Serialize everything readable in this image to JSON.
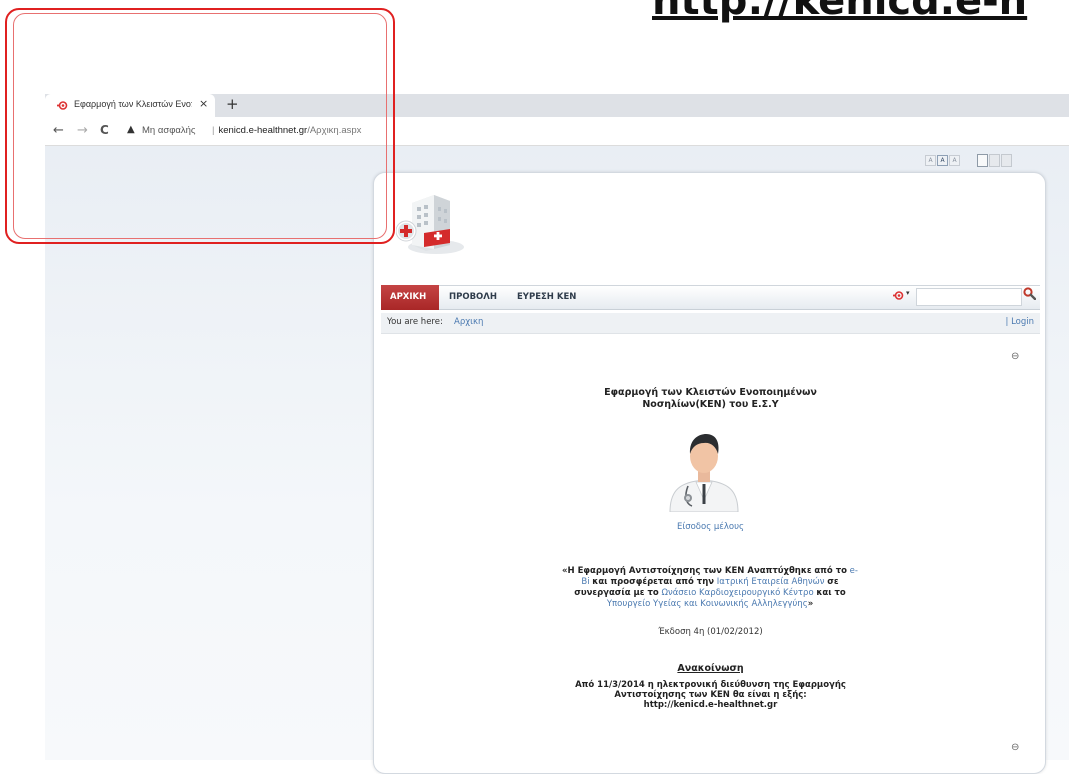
{
  "overlay": {
    "big_url": "http://kenicd.e-h"
  },
  "browser": {
    "tab_title": "Εφαρμογή των Κλειστών Ενοποι",
    "tab_close": "×",
    "new_tab": "+",
    "back_icon": "←",
    "forward_icon": "→",
    "reload_icon": "C",
    "warning_icon": "▲",
    "insecure_label": "Μη ασφαλής",
    "separator": "|",
    "url_host": "kenicd.e-healthnet.gr",
    "url_path": "/Αρχικη.aspx"
  },
  "size_controls": {
    "font_small": "A",
    "font_medium": "A",
    "font_large": "A"
  },
  "menu": {
    "items": [
      {
        "label": "ΑΡΧΙΚΗ",
        "active": true
      },
      {
        "label": "ΠΡΟΒΟΛΗ"
      },
      {
        "label": "ΕΥΡΕΣΗ ΚΕΝ"
      }
    ],
    "lang_caret": "▾"
  },
  "breadcrumb": {
    "label": "You are here:",
    "current": "Αρχικη",
    "login": "| Login"
  },
  "collapse_icon": "⊖",
  "content": {
    "title_line1": "Εφαρμογή των Κλειστών Ενοποιημένων",
    "title_line2": "Νοσηλίων(ΚΕΝ) του Ε.Σ.Υ",
    "member_login": "Είσοδος μέλους",
    "desc": {
      "part1": "«Η Εφαρμογή Αντιστοίχησης των ΚΕΝ Αναπτύχθηκε",
      "part2": "από το",
      "link_ebi": "e-Bi",
      "part3": "και προσφέρεται από την",
      "link_hospital": "Ιατρική Εταιρεία Αθηνών",
      "part4": "σε συνεργασία με το",
      "link_center": "Ωνάσειο Καρδιοχειρουργικό Κέντρο",
      "part5": "και το",
      "link_ministry": "Υπουργείο Υγείας και Κοινωνικής Αλληλεγγύης",
      "part6": "»"
    },
    "version": "Έκδοση 4η (01/02/2012)",
    "announcement_title": "Ανακοίνωση",
    "announcement_line1": "Από 11/3/2014 η ηλεκτρονική διεύθυνση της Εφαρμογής",
    "announcement_line2": "Αντιστοίχησης των ΚΕΝ θα είναι η εξής:",
    "announcement_line3": "http://kenicd.e-healthnet.gr"
  },
  "colors": {
    "highlight": "#e02020",
    "menu_active": "#b42f2f",
    "link": "#4a79b0"
  }
}
